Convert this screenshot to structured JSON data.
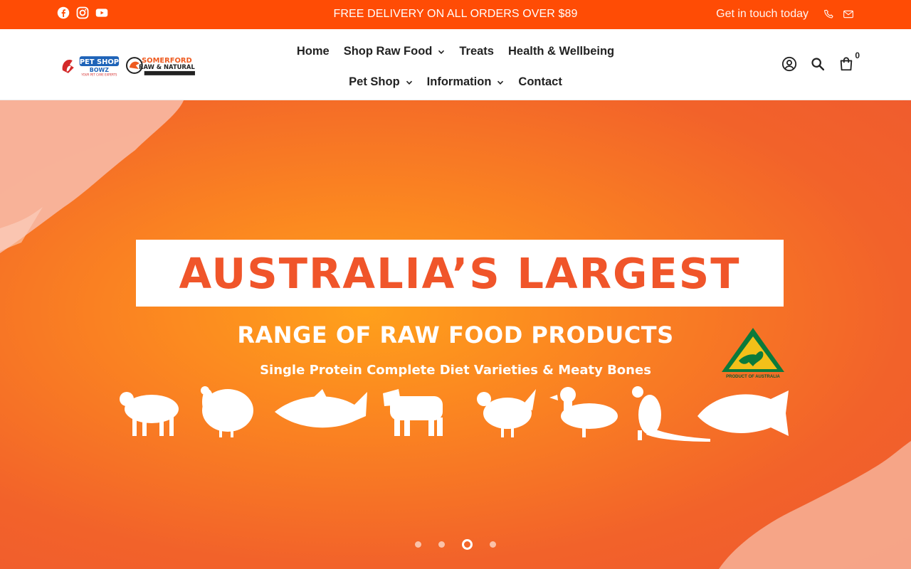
{
  "topbar": {
    "announcement": "FREE DELIVERY ON ALL ORDERS OVER $89",
    "contact_label": "Get in touch today",
    "social": [
      "facebook-icon",
      "instagram-icon",
      "youtube-icon"
    ],
    "contact_icons": [
      "phone-icon",
      "mail-icon"
    ],
    "background": "#ff4c05"
  },
  "header": {
    "logo_left_text": "PET SHOP BOWZ",
    "logo_left_tagline": "YOUR PET CARE EXPERTS",
    "logo_right_text": "SOMERFORD",
    "logo_right_sub": "RAW & NATURAL",
    "nav": [
      {
        "label": "Home",
        "dropdown": false
      },
      {
        "label": "Shop Raw Food",
        "dropdown": true
      },
      {
        "label": "Treats",
        "dropdown": false
      },
      {
        "label": "Health & Wellbeing",
        "dropdown": false
      },
      {
        "label": "Pet Shop",
        "dropdown": true
      },
      {
        "label": "Information",
        "dropdown": true
      },
      {
        "label": "Contact",
        "dropdown": false
      }
    ],
    "cart_count": "0",
    "icons": [
      "account-icon",
      "search-icon",
      "cart-icon"
    ]
  },
  "hero": {
    "headline": "AUSTRALIA’S LARGEST",
    "subheadline": "RANGE OF RAW FOOD PRODUCTS",
    "tagline": "Single Protein Complete Diet Varieties & Meaty Bones",
    "badge_caption": "PRODUCT OF AUSTRALIA",
    "animals": [
      "lamb",
      "turkey",
      "salmon",
      "beef",
      "chicken",
      "duck",
      "kangaroo",
      "barramundi"
    ],
    "slides_total": 4,
    "active_slide": 3,
    "accent": "#f0552a"
  }
}
